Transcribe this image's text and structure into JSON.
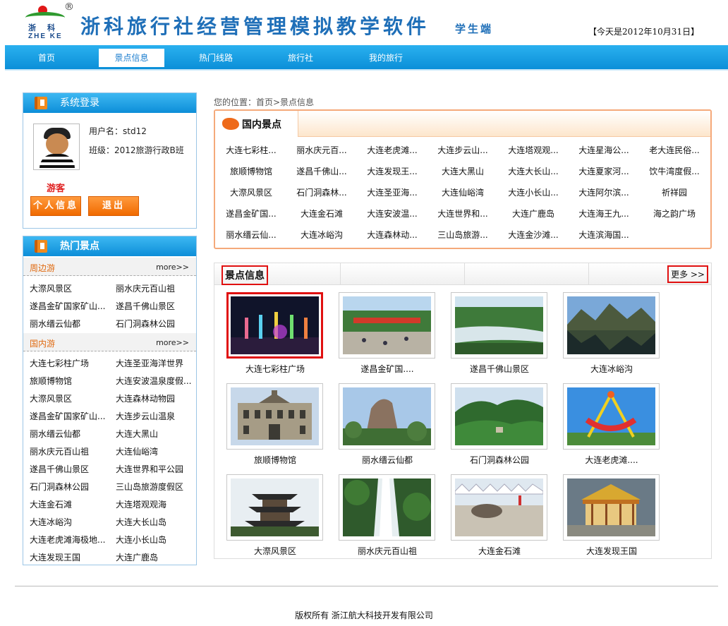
{
  "header": {
    "logo": {
      "reg": "®",
      "zh": "浙科",
      "en": "ZHE KE"
    },
    "title": "浙科旅行社经营管理模拟教学软件",
    "subtitle": "学生端",
    "today": "【今天是2012年10月31日】"
  },
  "nav": {
    "items": [
      {
        "label": "首页"
      },
      {
        "label": "景点信息",
        "active": true
      },
      {
        "label": "热门线路"
      },
      {
        "label": "旅行社"
      },
      {
        "label": "我的旅行"
      }
    ]
  },
  "login": {
    "title": "系统登录",
    "username_label": "用户名：",
    "username": "std12",
    "class_label": "班级：",
    "class_name": "2012旅游行政B班",
    "guest": "游客",
    "profile_button": "个人信息",
    "logout_button": "退出"
  },
  "hot": {
    "title": "热门景点",
    "nearby": {
      "title": "周边游",
      "more": "more>>",
      "items": [
        "大漈风景区",
        "丽水庆元百山祖",
        "遂昌金矿国家矿山...",
        "遂昌千佛山景区",
        "丽水缙云仙都",
        "石门洞森林公园"
      ]
    },
    "domestic": {
      "title": "国内游",
      "more": "more>>",
      "items": [
        "大连七彩柱广场",
        "大连圣亚海洋世界",
        "旅顺博物馆",
        "大连安波温泉度假...",
        "大漈风景区",
        "大连森林动物园",
        "遂昌金矿国家矿山...",
        "大连步云山温泉",
        "丽水缙云仙都",
        "大连大黑山",
        "丽水庆元百山祖",
        "大连仙峪湾",
        "遂昌千佛山景区",
        "大连世界和平公园",
        "石门洞森林公园",
        "三山岛旅游度假区",
        "大连金石滩",
        "大连塔观观海",
        "大连冰峪沟",
        "大连大长山岛",
        "大连老虎滩海极地...",
        "大连小长山岛",
        "大连发现王国",
        "大连广鹿岛"
      ]
    }
  },
  "breadcrumb": "您的位置：首页>景点信息",
  "domestic_box": {
    "title": "国内景点",
    "rows": [
      [
        "大连七彩柱...",
        "丽水庆元百...",
        "大连老虎滩...",
        "大连步云山...",
        "大连塔观观...",
        "大连星海公...",
        "老大连民俗..."
      ],
      [
        "旅顺博物馆",
        "遂昌千佛山...",
        "大连发现王...",
        "大连大黑山",
        "大连大长山...",
        "大连夏家河...",
        "饮牛湾度假..."
      ],
      [
        "大漈风景区",
        "石门洞森林...",
        "大连圣亚海...",
        "大连仙峪湾",
        "大连小长山...",
        "大连阿尔滨...",
        "祈祥园"
      ],
      [
        "遂昌金矿国...",
        "大连金石滩",
        "大连安波温...",
        "大连世界和...",
        "大连广鹿岛",
        "大连海王九...",
        "海之韵广场"
      ],
      [
        "丽水缙云仙...",
        "大连冰峪沟",
        "大连森林动...",
        "三山岛旅游...",
        "大连金沙滩...",
        "大连滨海国..."
      ]
    ]
  },
  "spots": {
    "title": "景点信息",
    "more": "更多 >>",
    "items": [
      {
        "caption": "大连七彩柱广场",
        "icon": "night-lights-photo"
      },
      {
        "caption": "遂昌金矿国....",
        "icon": "plaza-photo"
      },
      {
        "caption": "遂昌千佛山景区",
        "icon": "river-photo"
      },
      {
        "caption": "大连冰峪沟",
        "icon": "lake-mountain-photo"
      },
      {
        "caption": "旅顺博物馆",
        "icon": "museum-photo"
      },
      {
        "caption": "丽水缙云仙都",
        "icon": "rock-peak-photo"
      },
      {
        "caption": "石门洞森林公园",
        "icon": "forest-photo"
      },
      {
        "caption": "大连老虎滩....",
        "icon": "ride-photo"
      },
      {
        "caption": "大漈风景区",
        "icon": "pagoda-photo"
      },
      {
        "caption": "丽水庆元百山祖",
        "icon": "waterfall-photo"
      },
      {
        "caption": "大连金石滩",
        "icon": "beach-stone-photo"
      },
      {
        "caption": "大连发现王国",
        "icon": "carousel-photo"
      }
    ]
  },
  "footer": "版权所有 浙江航大科技开发有限公司",
  "colors": {
    "nav_blue": "#0b8fd8",
    "orange": "#f06a00",
    "red_highlight": "#e01010",
    "orange_border": "#f5a97a"
  }
}
